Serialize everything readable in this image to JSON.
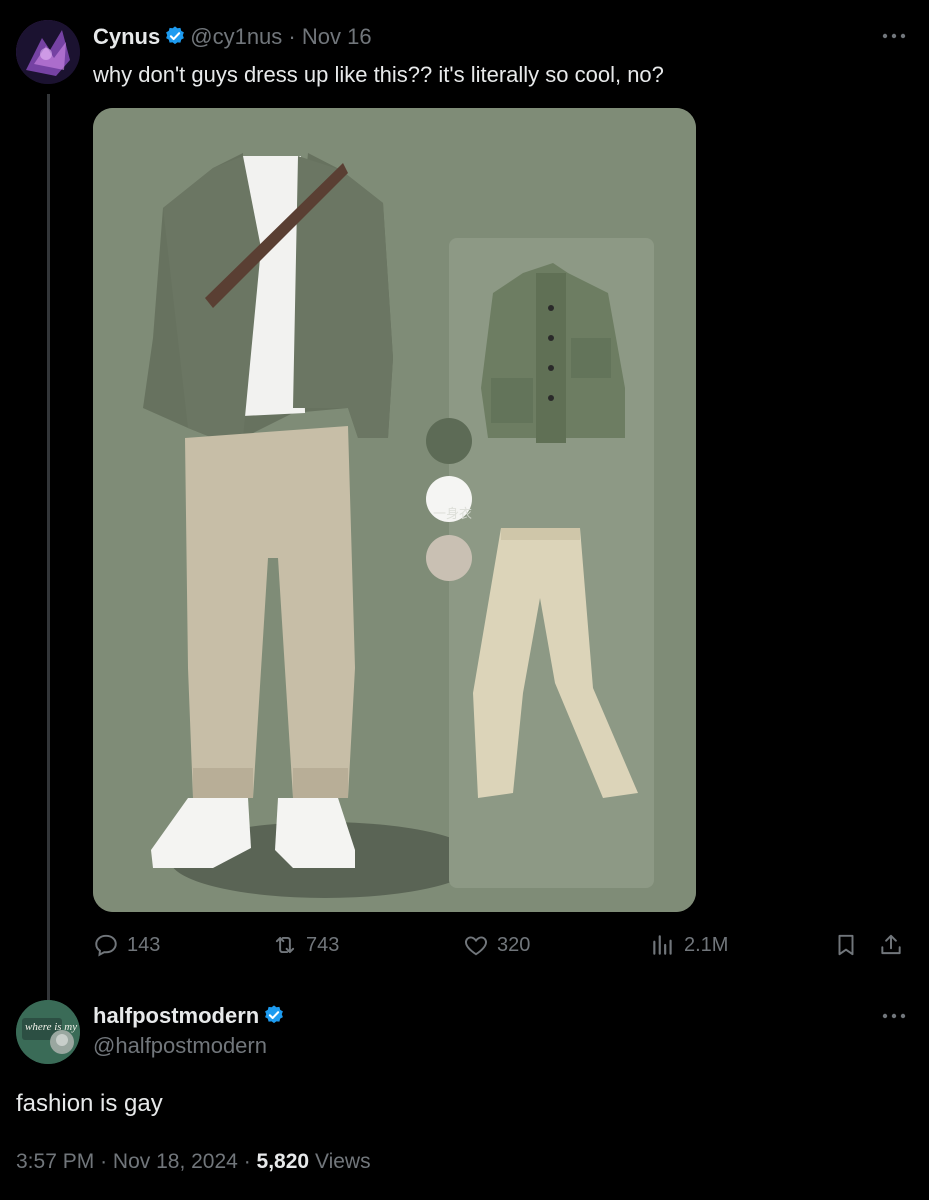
{
  "tweet": {
    "author_name": "Cynus",
    "author_handle": "@cy1nus",
    "separator": "·",
    "date": "Nov 16",
    "text": "why don't guys dress up like this?? it's literally so cool, no?",
    "image_watermark": "一身衣",
    "actions": {
      "replies": "143",
      "reposts": "743",
      "likes": "320",
      "views": "2.1M"
    }
  },
  "reply": {
    "author_name": "halfpostmodern",
    "author_handle": "@halfpostmodern",
    "text": "fashion is gay",
    "avatar_text": "where is my",
    "time": "3:57 PM",
    "date": "Nov 18, 2024",
    "views_count": "5,820",
    "views_label": "Views",
    "separator": "·"
  },
  "icons": {
    "verified": "verified-badge-icon",
    "more": "more-dots-icon",
    "reply": "reply-icon",
    "repost": "repost-icon",
    "like": "heart-icon",
    "views": "analytics-icon",
    "bookmark": "bookmark-icon",
    "share": "share-icon"
  },
  "colors": {
    "background": "#000000",
    "text": "#e7e9ea",
    "muted": "#71767b",
    "verified": "#1d9bf0",
    "media_bg": "#7f8c77"
  }
}
